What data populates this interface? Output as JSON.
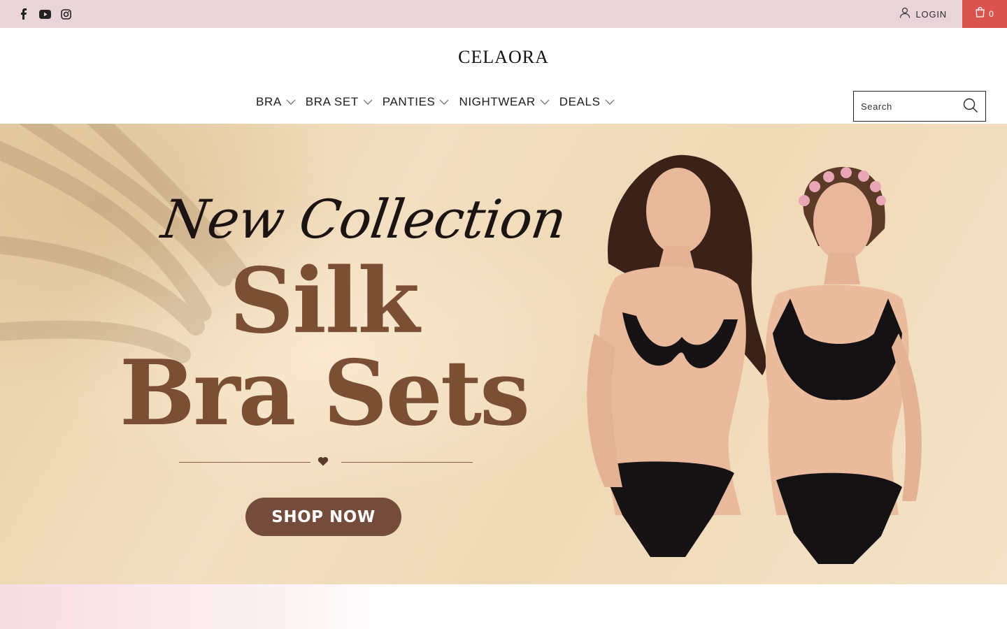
{
  "topbar": {
    "social": [
      {
        "icon": "facebook-icon"
      },
      {
        "icon": "youtube-icon"
      },
      {
        "icon": "instagram-icon"
      }
    ],
    "login_label": "LOGIN",
    "cart_count": "0",
    "colors": {
      "background": "#e8d4d9",
      "cart": "#d9534f"
    }
  },
  "header": {
    "logo": "CELAORA",
    "nav": [
      {
        "label": "BRA"
      },
      {
        "label": "BRA SET"
      },
      {
        "label": "PANTIES"
      },
      {
        "label": "NIGHTWEAR"
      },
      {
        "label": "DEALS"
      }
    ],
    "search": {
      "placeholder": "Search",
      "value": ""
    }
  },
  "hero": {
    "script_title": "New Collection",
    "headline_line1": "Silk",
    "headline_line2": "Bra Sets",
    "cta_label": "SHOP NOW",
    "colors": {
      "headline": "#7b4f33",
      "cta": "#744c3c",
      "background": "#efd9b6"
    }
  }
}
